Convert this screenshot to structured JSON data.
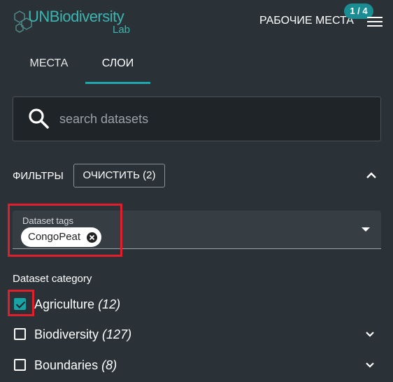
{
  "header": {
    "logo_un": "UN",
    "logo_bio": "Biodiversity",
    "logo_lab": "Lab",
    "workspaces_label": "РАБОЧИЕ МЕСТА",
    "workspaces_badge": "1 / 4"
  },
  "tabs": [
    {
      "label": "МЕСТА",
      "active": false
    },
    {
      "label": "СЛОИ",
      "active": true
    }
  ],
  "search": {
    "placeholder": "search datasets",
    "value": ""
  },
  "filters": {
    "label": "ФИЛЬТРЫ",
    "clear_label": "ОЧИСТИТЬ (2)"
  },
  "dataset_tags": {
    "label": "Dataset tags",
    "selected": [
      "CongoPeat"
    ]
  },
  "dataset_category": {
    "title": "Dataset category",
    "items": [
      {
        "name": "Agriculture",
        "count": "(12)",
        "checked": true,
        "expandable": false
      },
      {
        "name": "Biodiversity",
        "count": "(127)",
        "checked": false,
        "expandable": true
      },
      {
        "name": "Boundaries",
        "count": "(8)",
        "checked": false,
        "expandable": true
      }
    ]
  },
  "colors": {
    "background": "#2b3237",
    "accent": "#1fa7ae",
    "highlight": "#e01e2c"
  }
}
